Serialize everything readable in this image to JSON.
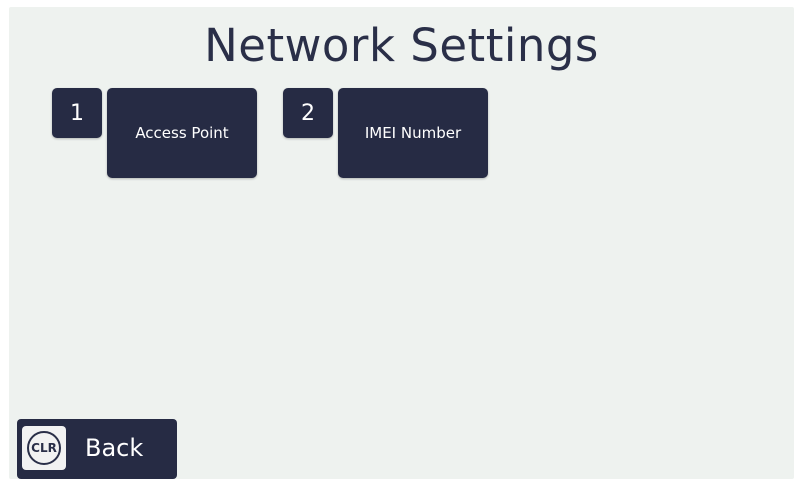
{
  "header": {
    "title": "Network Settings"
  },
  "menu": {
    "items": [
      {
        "key": "1",
        "label": "Access Point"
      },
      {
        "key": "2",
        "label": "IMEI Number"
      }
    ]
  },
  "footer": {
    "back_icon_text": "CLR",
    "back_label": "Back"
  }
}
